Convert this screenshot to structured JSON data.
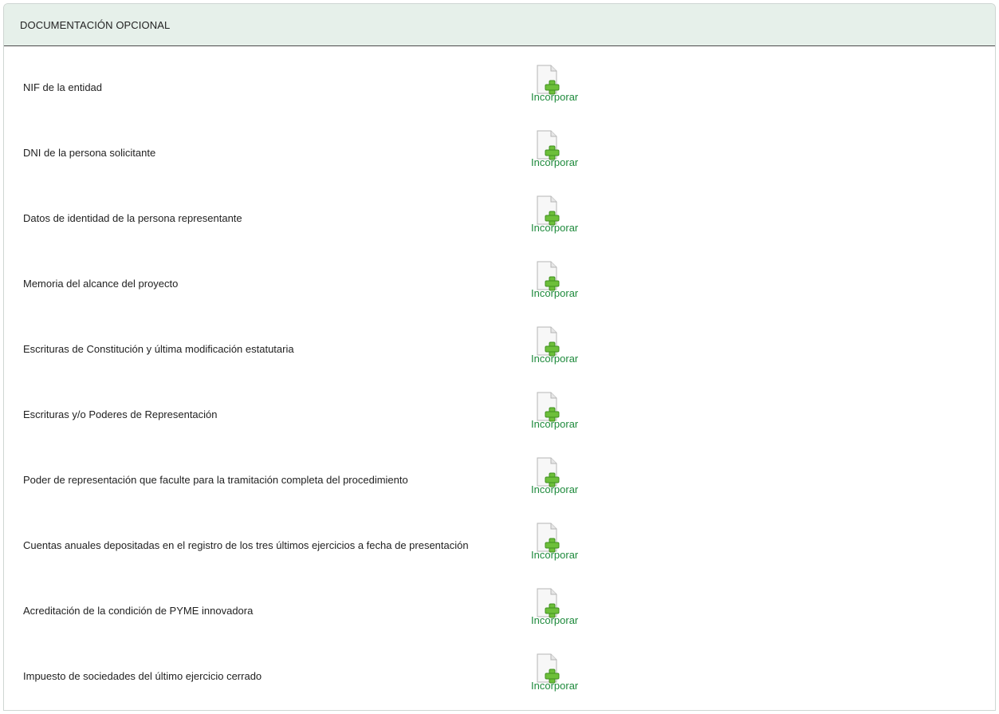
{
  "panel": {
    "title": "DOCUMENTACIÓN OPCIONAL"
  },
  "documents": [
    {
      "label": "NIF de la entidad",
      "action": "Incorporar",
      "icon": "file-add-icon"
    },
    {
      "label": "DNI de la persona solicitante",
      "action": "Incorporar",
      "icon": "file-add-icon"
    },
    {
      "label": "Datos de identidad de la persona representante",
      "action": "Incorporar",
      "icon": "file-add-icon"
    },
    {
      "label": "Memoria del alcance del proyecto",
      "action": "Incorporar",
      "icon": "file-add-icon"
    },
    {
      "label": "Escrituras de Constitución y última modificación estatutaria",
      "action": "Incorporar",
      "icon": "file-add-icon"
    },
    {
      "label": "Escrituras y/o Poderes de Representación",
      "action": "Incorporar",
      "icon": "file-add-icon"
    },
    {
      "label": "Poder de representación que faculte para la tramitación completa del procedimiento",
      "action": "Incorporar",
      "icon": "file-add-icon"
    },
    {
      "label": "Cuentas anuales depositadas en el registro de los tres últimos ejercicios a fecha de presentación",
      "action": "Incorporar",
      "icon": "file-add-icon"
    },
    {
      "label": "Acreditación de la condición de PYME innovadora",
      "action": "Incorporar",
      "icon": "file-add-icon"
    },
    {
      "label": "Impuesto de sociedades del último ejercicio cerrado",
      "action": "Incorporar",
      "icon": "file-add-icon"
    }
  ],
  "colors": {
    "header_bg": "#e6f0ea",
    "action_green": "#1e8a3c",
    "plus_green": "#6dbf3a"
  }
}
